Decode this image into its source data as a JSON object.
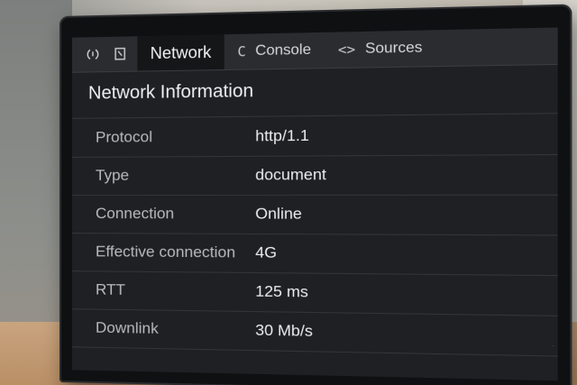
{
  "toolbar": {
    "icons": [
      "inspect-element-icon",
      "device-toggle-icon"
    ],
    "tabs": [
      {
        "label": "Network",
        "glyph": "",
        "active": true
      },
      {
        "label": "Console",
        "glyph": "C",
        "active": false
      },
      {
        "label": "Sources",
        "glyph": "<>",
        "active": false
      }
    ]
  },
  "panel": {
    "title": "Network Information",
    "rows": [
      {
        "key": "Protocol",
        "value": "http/1.1"
      },
      {
        "key": "Type",
        "value": "document"
      },
      {
        "key": "Connection",
        "value": "Online"
      },
      {
        "key": "Effective connection",
        "value": "4G"
      },
      {
        "key": "RTT",
        "value": "125 ms"
      },
      {
        "key": "Downlink",
        "value": "30 Mb/s"
      }
    ]
  },
  "colors": {
    "screen_bg": "#1e2023",
    "toolbar_bg": "#2a2c2f",
    "active_tab_bg": "#151618",
    "text_primary": "#eceef0",
    "text_secondary": "#b7bbc0"
  }
}
